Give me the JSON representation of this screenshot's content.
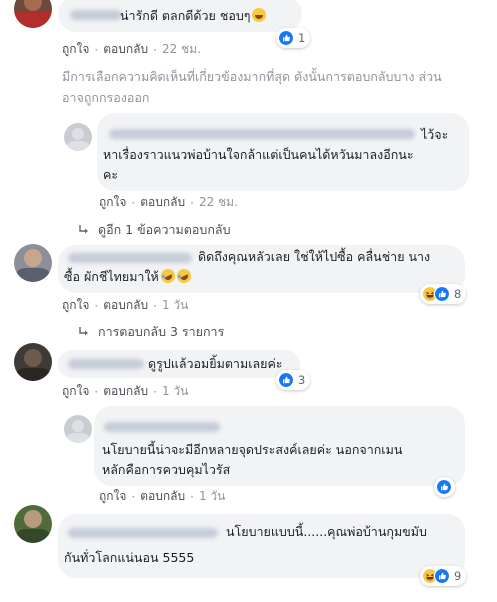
{
  "actions": {
    "like_label": "ถูกใจ",
    "reply_label": "ตอบกลับ",
    "separator": "·"
  },
  "filter_notice": "มีการเลือกความคิดเห็นที่เกี่ยวข้องมากที่สุด ดังนั้นการตอบกลับบาง ส่วนอาจถูกกรองออก",
  "comments": [
    {
      "text_line1": "น่ารักดี ตลกดีด้วย ชอบๆ",
      "time": "22 ชม.",
      "reaction_count": "1",
      "reactions": [
        "like-icon"
      ]
    },
    {
      "text_line1": "ไว้จะ",
      "text_line2": "หาเรื่องราวแนวพ่อบ้านใจกล้าแต่เป็นคนได้หวันมาลงอีกนะ",
      "text_line3": "คะ",
      "time": "22 ชม."
    },
    {
      "view_more": "ดูอีก 1 ข้อความตอบกลับ"
    },
    {
      "text_line1": "ดิดถึงคุณหลัวเลย ใช่ให้ไปซื้อ คลื่นช่าย นาง",
      "text_line2": "ซื้อ ผักชีไทยมาให้",
      "time": "1 วัน",
      "reaction_count": "8",
      "reactions": [
        "haha-icon",
        "like-icon"
      ]
    },
    {
      "view_more": "การตอบกลับ 3 รายการ"
    },
    {
      "text_line1": "ดูรูปแล้วอมยิ้มตามเลยค่ะ",
      "time": "1 วัน",
      "reaction_count": "3",
      "reactions": [
        "like-icon"
      ]
    },
    {
      "text_line1": "นโยบายนี้น่าจะมีอีกหลายจุดประสงค์เลยค่ะ นอกจากเมน",
      "text_line2": "หลักคือการควบคุมไวรัส",
      "time": "1 วัน",
      "reactions": [
        "like-icon"
      ]
    },
    {
      "text_line1": "นโยบายแบบนี้......คุณพ่อบ้านกุมขมับ",
      "text_line2": "กันทั่วโลกแน่นอน 5555",
      "reaction_count": "9",
      "reactions": [
        "haha-icon",
        "like-icon"
      ]
    }
  ],
  "colors": {
    "like": "#1877f2",
    "haha": "#f7c844",
    "bubble": "#f2f3f5",
    "meta": "#90949c"
  }
}
